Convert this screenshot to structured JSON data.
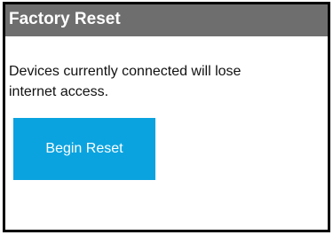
{
  "dialog": {
    "title": "Factory Reset",
    "message_line_1": "Devices currently connected will lose",
    "message_line_2": "internet access.",
    "button_label": "Begin Reset"
  },
  "colors": {
    "title_bar": "#6e6e6e",
    "button": "#0aa3e0",
    "border": "#000000"
  }
}
